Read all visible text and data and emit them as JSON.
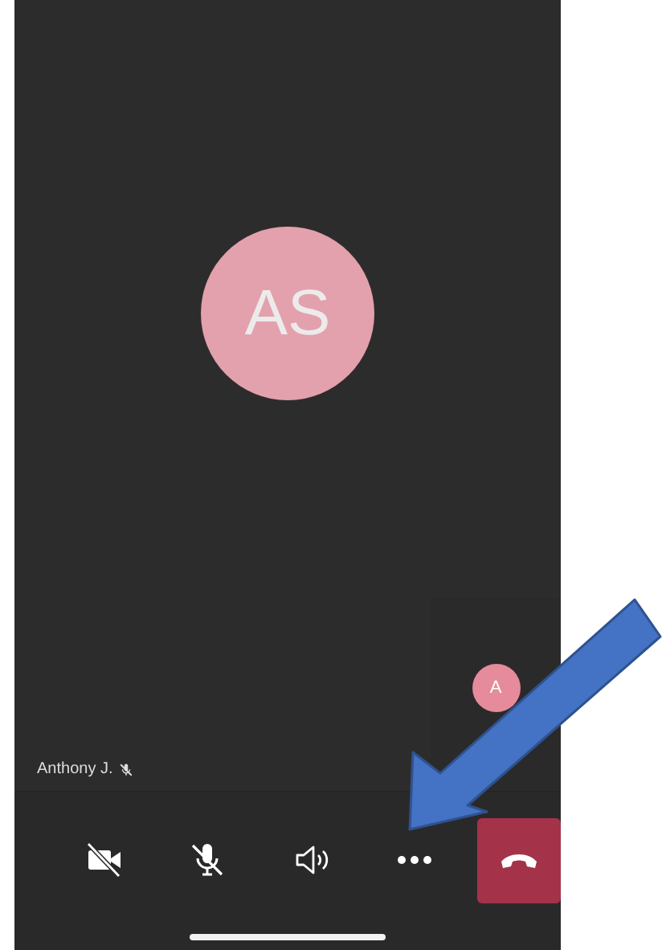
{
  "caller": {
    "initials": "AS"
  },
  "self_view": {
    "initials": "A"
  },
  "participant": {
    "name": "Anthony J.",
    "muted": true
  },
  "controls": [
    {
      "kind": "video",
      "on": false
    },
    {
      "kind": "mic",
      "on": false
    },
    {
      "kind": "speaker"
    },
    {
      "kind": "more"
    },
    {
      "kind": "hangup"
    }
  ],
  "annotation": {
    "kind": "arrow"
  }
}
